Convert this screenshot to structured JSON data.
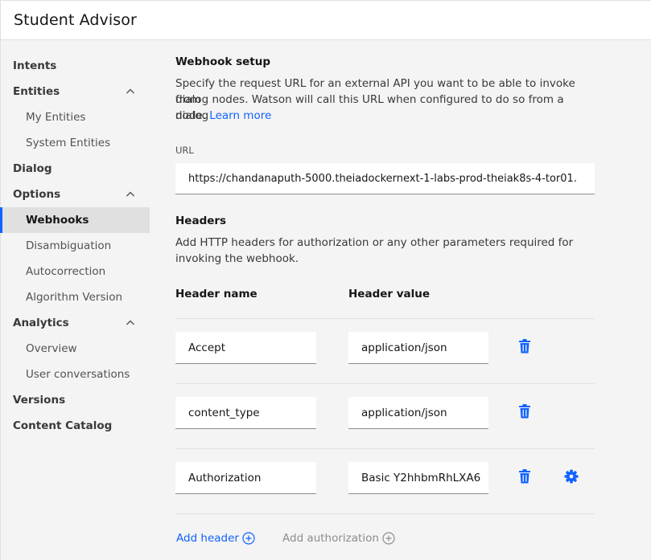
{
  "app": {
    "title": "Student Advisor"
  },
  "sidebar": {
    "items": [
      {
        "label": "Intents",
        "level": "top"
      },
      {
        "label": "Entities",
        "level": "top",
        "expanded": true
      },
      {
        "label": "My Entities",
        "level": "sub"
      },
      {
        "label": "System Entities",
        "level": "sub"
      },
      {
        "label": "Dialog",
        "level": "top"
      },
      {
        "label": "Options",
        "level": "top",
        "expanded": true
      },
      {
        "label": "Webhooks",
        "level": "sub",
        "active": true
      },
      {
        "label": "Disambiguation",
        "level": "sub"
      },
      {
        "label": "Autocorrection",
        "level": "sub"
      },
      {
        "label": "Algorithm Version",
        "level": "sub"
      },
      {
        "label": "Analytics",
        "level": "top",
        "expanded": true
      },
      {
        "label": "Overview",
        "level": "sub"
      },
      {
        "label": "User conversations",
        "level": "sub"
      },
      {
        "label": "Versions",
        "level": "top"
      },
      {
        "label": "Content Catalog",
        "level": "top"
      }
    ]
  },
  "webhook": {
    "title": "Webhook setup",
    "desc_1": "Specify the request URL for an external API you want to be able to invoke from",
    "desc_2": "dialog nodes. Watson will call this URL when configured to do so from a dialog",
    "desc_3": "node.",
    "learn_more": "Learn more",
    "url_label": "URL",
    "url_value": "https://chandanaputh-5000.theiadockernext-1-labs-prod-theiak8s-4-tor01."
  },
  "headers": {
    "title": "Headers",
    "desc_1": "Add HTTP headers for authorization or any other parameters required for",
    "desc_2": "invoking the webhook.",
    "col_name": "Header name",
    "col_value": "Header value",
    "rows": [
      {
        "name": "Accept",
        "value": "application/json"
      },
      {
        "name": "content_type",
        "value": "application/json"
      },
      {
        "name": "Authorization",
        "value": "Basic Y2hhbmRhLXA6"
      }
    ],
    "add_header": "Add header",
    "add_authorization": "Add authorization"
  },
  "colors": {
    "accent": "#0f62fe",
    "disabled": "#8d8d8d"
  },
  "icons": {
    "delete": "trash-can-icon",
    "settings": "gear-icon",
    "add": "add-circle-icon",
    "expand": "chevron-up-icon"
  }
}
